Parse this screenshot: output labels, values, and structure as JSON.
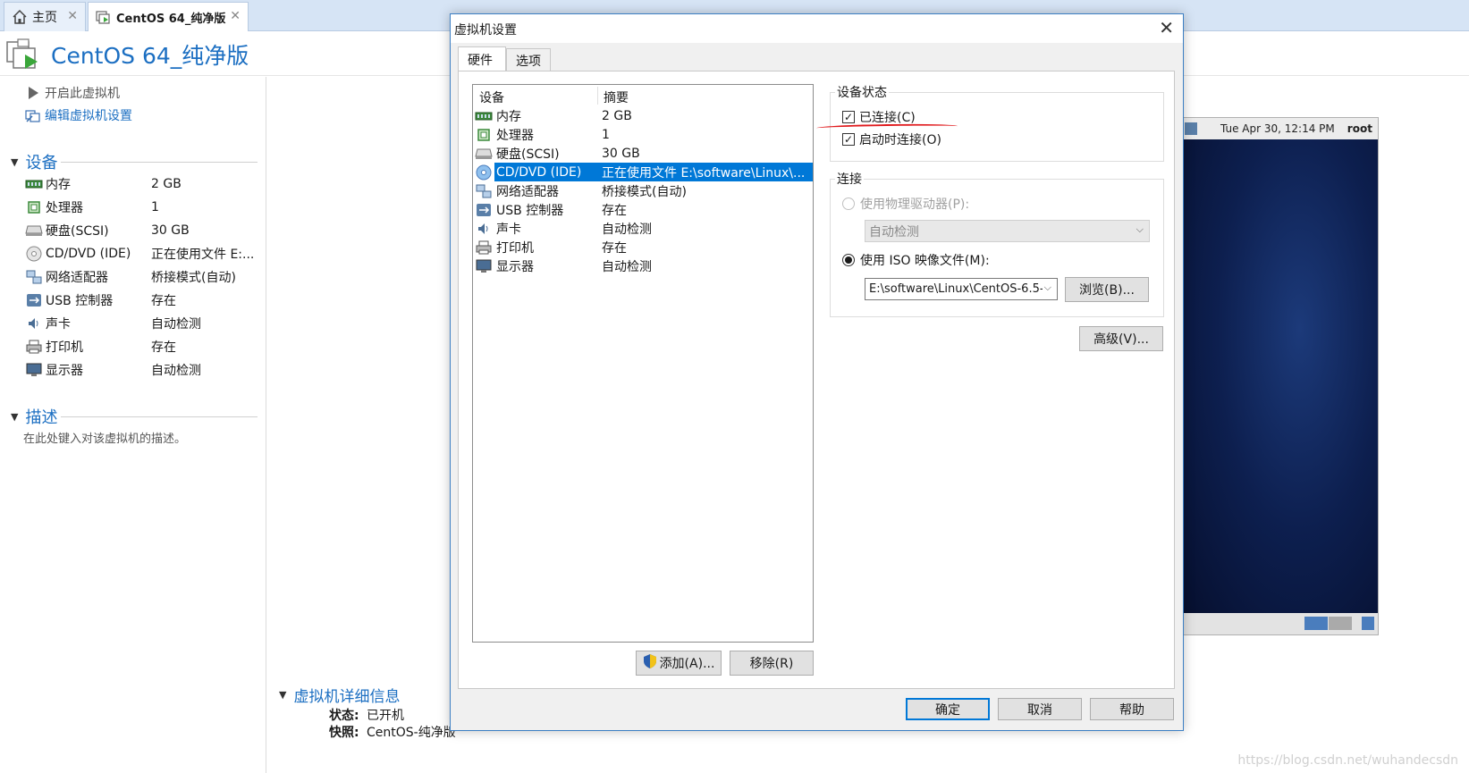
{
  "tabs": [
    {
      "label": "主页"
    },
    {
      "label": "CentOS 64_纯净版"
    }
  ],
  "vm": {
    "title": "CentOS 64_纯净版"
  },
  "actions": {
    "power_on": "开启此虚拟机",
    "edit_settings": "编辑虚拟机设置"
  },
  "sections": {
    "devices": "设备",
    "description": "描述",
    "description_text": "在此处键入对该虚拟机的描述。",
    "details": "虚拟机详细信息"
  },
  "left_devices": [
    {
      "name": "内存",
      "value": "2 GB",
      "icon": "memory-icon"
    },
    {
      "name": "处理器",
      "value": "1",
      "icon": "cpu-icon"
    },
    {
      "name": "硬盘(SCSI)",
      "value": "30 GB",
      "icon": "harddisk-icon"
    },
    {
      "name": "CD/DVD (IDE)",
      "value": "正在使用文件 E:...",
      "icon": "cd-dvd-icon"
    },
    {
      "name": "网络适配器",
      "value": "桥接模式(自动)",
      "icon": "network-icon"
    },
    {
      "name": "USB 控制器",
      "value": "存在",
      "icon": "usb-icon"
    },
    {
      "name": "声卡",
      "value": "自动检测",
      "icon": "sound-icon"
    },
    {
      "name": "打印机",
      "value": "存在",
      "icon": "printer-icon"
    },
    {
      "name": "显示器",
      "value": "自动检测",
      "icon": "display-icon"
    }
  ],
  "details": {
    "status_label": "状态:",
    "status_value": "已开机",
    "snapshot_label": "快照:",
    "snapshot_value": "CentOS-纯净版"
  },
  "console": {
    "clock": "Tue Apr 30, 12:14 PM",
    "user": "root"
  },
  "dialog": {
    "title": "虚拟机设置",
    "tabs": [
      {
        "label": "硬件"
      },
      {
        "label": "选项"
      }
    ],
    "list_headers": {
      "device": "设备",
      "summary": "摘要"
    },
    "devices": [
      {
        "name": "内存",
        "value": "2 GB",
        "icon": "memory-icon"
      },
      {
        "name": "处理器",
        "value": "1",
        "icon": "cpu-icon"
      },
      {
        "name": "硬盘(SCSI)",
        "value": "30 GB",
        "icon": "harddisk-icon"
      },
      {
        "name": "CD/DVD (IDE)",
        "value": "正在使用文件 E:\\software\\Linux\\...",
        "icon": "cd-dvd-icon",
        "selected": true
      },
      {
        "name": "网络适配器",
        "value": "桥接模式(自动)",
        "icon": "network-icon"
      },
      {
        "name": "USB 控制器",
        "value": "存在",
        "icon": "usb-icon"
      },
      {
        "name": "声卡",
        "value": "自动检测",
        "icon": "sound-icon"
      },
      {
        "name": "打印机",
        "value": "存在",
        "icon": "printer-icon"
      },
      {
        "name": "显示器",
        "value": "自动检测",
        "icon": "display-icon"
      }
    ],
    "add_button": "添加(A)...",
    "remove_button": "移除(R)",
    "device_status": {
      "label": "设备状态",
      "connected": "已连接(C)",
      "connected_checked": true,
      "connect_at_power_on": "启动时连接(O)",
      "connect_at_power_on_checked": true
    },
    "connection": {
      "label": "连接",
      "physical_drive": "使用物理驱动器(P):",
      "physical_drive_value": "自动检测",
      "iso_image": "使用 ISO 映像文件(M):",
      "iso_path": "E:\\software\\Linux\\CentOS-6.5-",
      "browse": "浏览(B)..."
    },
    "advanced": "高级(V)...",
    "ok": "确定",
    "cancel": "取消",
    "help": "帮助"
  },
  "watermark": "https://blog.csdn.net/wuhandecsdn",
  "colors": {
    "accent": "#1c6fc2",
    "selection": "#0078d7",
    "annotation_red": "#e0191c"
  }
}
